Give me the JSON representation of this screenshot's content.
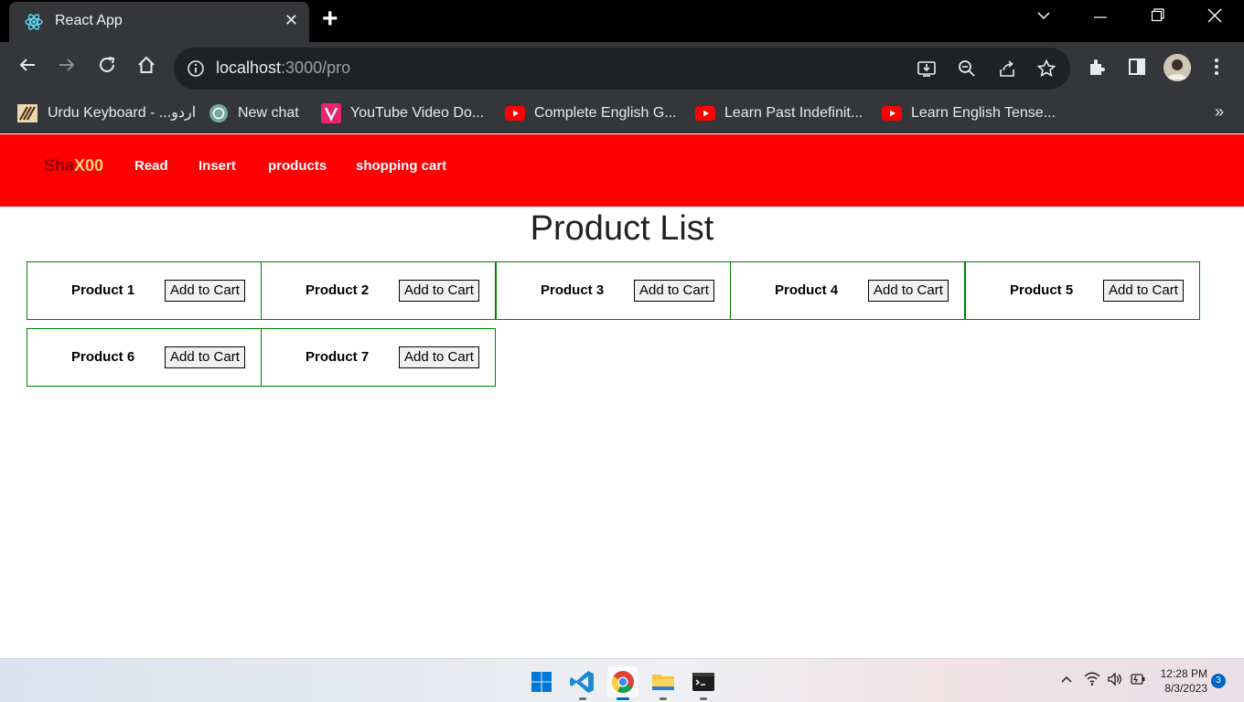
{
  "browser": {
    "tab_title": "React App",
    "url_host": "localhost",
    "url_rest": ":3000/pro",
    "bookmarks": [
      {
        "label": "Urdu Keyboard - ...اردو",
        "icon": "urdu-keyboard-icon"
      },
      {
        "label": "New chat",
        "icon": "chatgpt-icon"
      },
      {
        "label": "YouTube Video Do...",
        "icon": "video-downloader-icon"
      },
      {
        "label": "Complete English G...",
        "icon": "youtube-icon"
      },
      {
        "label": "Learn Past Indefinit...",
        "icon": "youtube-icon"
      },
      {
        "label": "Learn English Tense...",
        "icon": "youtube-icon"
      }
    ],
    "bookmarks_overflow": "»"
  },
  "navbar": {
    "brand_part1": "Sha",
    "brand_part2": "X00",
    "links": [
      "Read",
      "Insert",
      "products",
      "shopping cart"
    ]
  },
  "main": {
    "title": "Product List",
    "add_label": "Add to Cart",
    "products": [
      "Product 1",
      "Product 2",
      "Product 3",
      "Product 4",
      "Product 5",
      "Product 6",
      "Product 7"
    ]
  },
  "taskbar": {
    "time": "12:28 PM",
    "date": "8/3/2023",
    "notifications": "3"
  },
  "colors": {
    "navbar_bg": "#ff0000",
    "card_border": "#008000",
    "brand_dark": "#8b0000",
    "brand_light": "#ffd27f"
  }
}
